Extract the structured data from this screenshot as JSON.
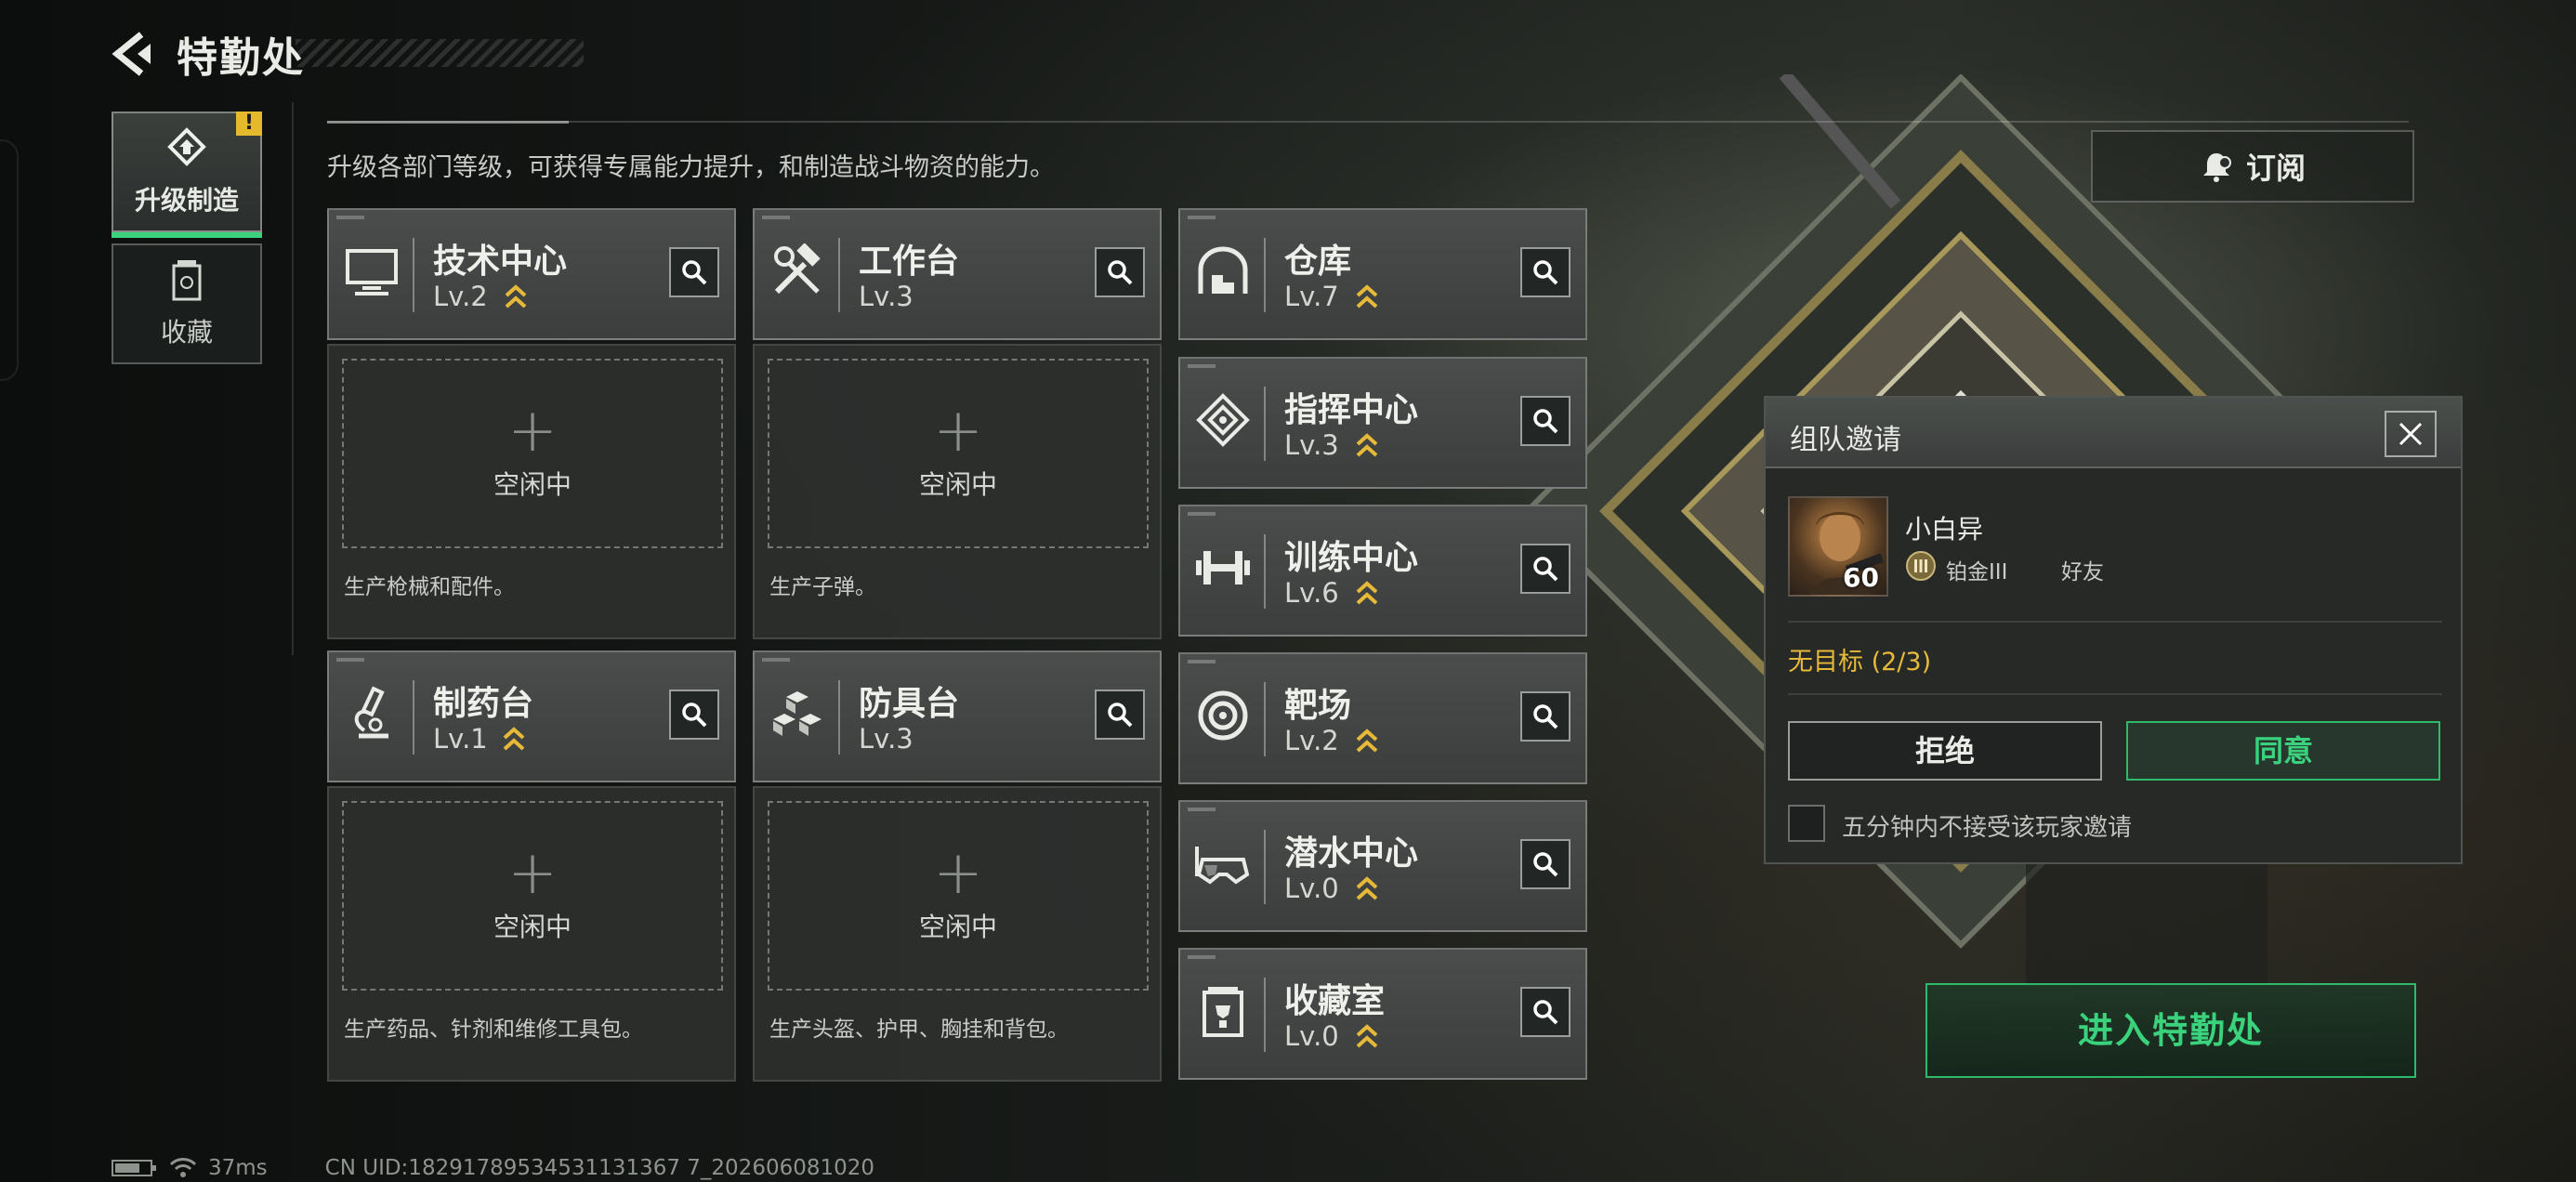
{
  "header": {
    "title": "特勤处"
  },
  "sidebar": {
    "upgrade_label": "升级制造",
    "upgrade_badge": "!",
    "collect_label": "收藏"
  },
  "description": "升级各部门等级，可获得专属能力提升，和制造战斗物资的能力。",
  "subscribe_label": "订阅",
  "left_stations": [
    {
      "name": "技术中心",
      "level": "Lv.2",
      "icon": "monitor-icon",
      "upgradable": true,
      "slot_status": "空闲中",
      "slot_desc": "生产枪械和配件。"
    },
    {
      "name": "工作台",
      "level": "Lv.3",
      "icon": "hammer-wrench-icon",
      "upgradable": false,
      "slot_status": "空闲中",
      "slot_desc": "生产子弹。"
    },
    {
      "name": "制药台",
      "level": "Lv.1",
      "icon": "microscope-icon",
      "upgradable": true,
      "slot_status": "空闲中",
      "slot_desc": "生产药品、针剂和维修工具包。"
    },
    {
      "name": "防具台",
      "level": "Lv.3",
      "icon": "armor-cubes-icon",
      "upgradable": false,
      "slot_status": "空闲中",
      "slot_desc": "生产头盔、护甲、胸挂和背包。"
    }
  ],
  "right_stations": [
    {
      "name": "仓库",
      "level": "Lv.7",
      "icon": "warehouse-icon",
      "upgradable": true
    },
    {
      "name": "指挥中心",
      "level": "Lv.3",
      "icon": "command-chip-icon",
      "upgradable": true
    },
    {
      "name": "训练中心",
      "level": "Lv.6",
      "icon": "dumbbell-icon",
      "upgradable": true
    },
    {
      "name": "靶场",
      "level": "Lv.2",
      "icon": "target-icon",
      "upgradable": true
    },
    {
      "name": "潜水中心",
      "level": "Lv.0",
      "icon": "diving-mask-icon",
      "upgradable": true
    },
    {
      "name": "收藏室",
      "level": "Lv.0",
      "icon": "trophy-case-icon",
      "upgradable": true
    }
  ],
  "invite": {
    "title": "组队邀请",
    "player_name": "小白异",
    "player_level": "60",
    "rank": "铂金III",
    "relation": "好友",
    "status": "无目标 (2/3)",
    "refuse_label": "拒绝",
    "accept_label": "同意",
    "mute_label": "五分钟内不接受该玩家邀请"
  },
  "enter_label": "进入特勤处",
  "footer": {
    "ping": "37ms",
    "uid": "CN UID:18291789534531131367 7_202606081020"
  },
  "colors": {
    "accent_green": "#3ad27c",
    "level_gold": "#e6b93a",
    "warning": "#e6b92c"
  }
}
